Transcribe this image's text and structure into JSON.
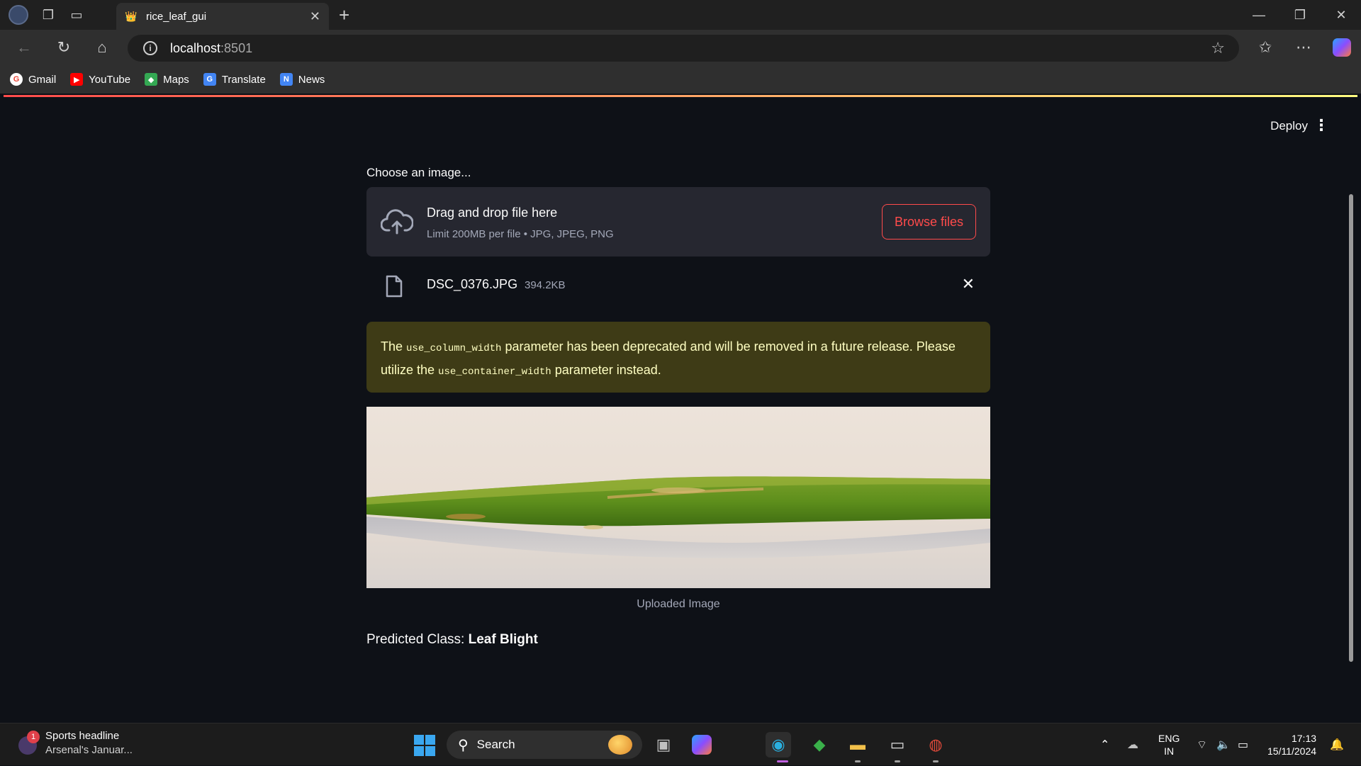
{
  "browser": {
    "tab_title": "rice_leaf_gui",
    "url_host": "localhost",
    "url_port": ":8501",
    "bookmarks": [
      {
        "label": "Gmail",
        "icon": "google-icon",
        "color": "#ea4335"
      },
      {
        "label": "YouTube",
        "icon": "youtube-icon",
        "color": "#ff0000"
      },
      {
        "label": "Maps",
        "icon": "maps-icon",
        "color": "#34a853"
      },
      {
        "label": "Translate",
        "icon": "translate-icon",
        "color": "#4285f4"
      },
      {
        "label": "News",
        "icon": "news-icon",
        "color": "#4285f4"
      }
    ]
  },
  "app": {
    "deploy_label": "Deploy",
    "uploader": {
      "label": "Choose an image...",
      "drop_title": "Drag and drop file here",
      "drop_sub": "Limit 200MB per file • JPG, JPEG, PNG",
      "browse_label": "Browse files"
    },
    "file": {
      "name": "DSC_0376.JPG",
      "size": "394.2KB"
    },
    "warning": {
      "t1": "The ",
      "code1": "use_column_width",
      "t2": " parameter has been deprecated and will be removed in a future release. Please utilize the ",
      "code2": "use_container_width",
      "t3": " parameter instead."
    },
    "image_caption": "Uploaded Image",
    "prediction": {
      "prefix": "Predicted Class: ",
      "value": "Leaf Blight"
    },
    "accent": "#ff4b4b"
  },
  "taskbar": {
    "news_title": "Sports headline",
    "news_sub": "Arsenal's Januar...",
    "news_badge": "1",
    "search_label": "Search",
    "lang_top": "ENG",
    "lang_bottom": "IN",
    "time": "17:13",
    "date": "15/11/2024"
  }
}
